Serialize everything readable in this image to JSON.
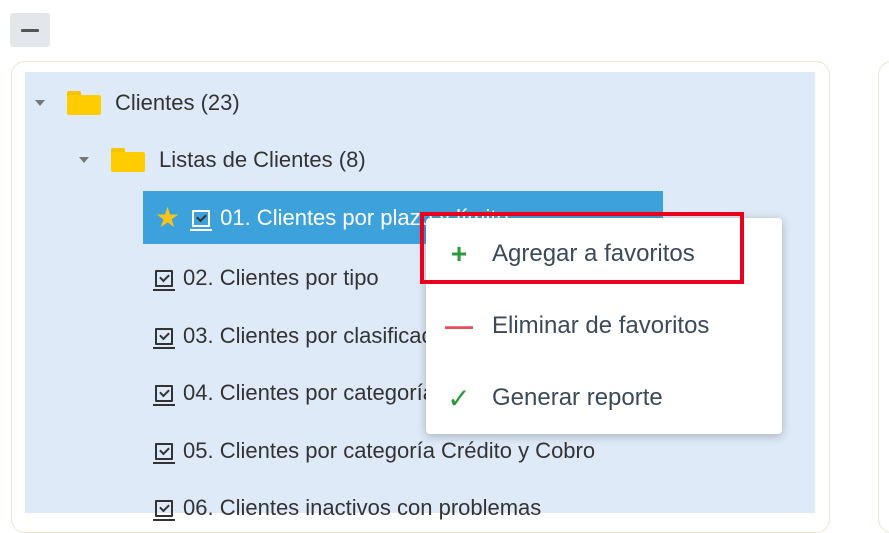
{
  "toolbar": {
    "collapse_icon": "minus-icon"
  },
  "tree": {
    "root": {
      "label": "Clientes (23)",
      "icon": "folder-icon"
    },
    "group": {
      "label": "Listas de Clientes (8)",
      "icon": "folder-icon"
    },
    "items": [
      {
        "label": "01. Clientes por plazo y límite",
        "selected": true,
        "favorite": true
      },
      {
        "label": "02. Clientes por tipo"
      },
      {
        "label": "03. Clientes por clasificación"
      },
      {
        "label": "04. Clientes por categoría"
      },
      {
        "label": "05. Clientes por categoría Crédito y Cobro"
      },
      {
        "label": "06. Clientes inactivos con problemas"
      }
    ]
  },
  "context_menu": {
    "items": [
      {
        "label": "Agregar a favoritos",
        "icon": "plus-icon",
        "highlighted": true
      },
      {
        "label": "Eliminar de favoritos",
        "icon": "minus-icon"
      },
      {
        "label": "Generar reporte",
        "icon": "check-icon"
      }
    ]
  },
  "colors": {
    "selection": "#3da1dc",
    "tree_background": "#dfeaf8",
    "folder": "#ffcc00",
    "star": "#f8c21c",
    "highlight_border": "#e8001c"
  }
}
